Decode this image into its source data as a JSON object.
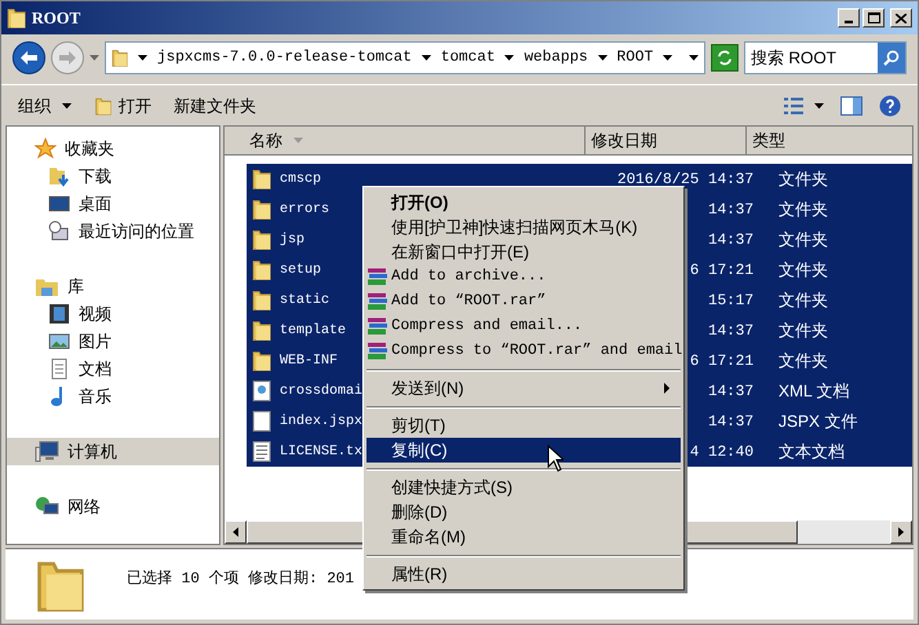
{
  "window": {
    "title": "ROOT"
  },
  "address_bar": {
    "crumbs": [
      "jspxcms-7.0.0-release-tomcat",
      "tomcat",
      "webapps",
      "ROOT"
    ],
    "search_placeholder": "搜索 ROOT"
  },
  "toolbar": {
    "organize": "组织",
    "open": "打开",
    "new_folder": "新建文件夹"
  },
  "sidebar": {
    "groups": [
      {
        "label": "收藏夹",
        "selected": false,
        "children": [
          {
            "label": "下载",
            "selected": false
          },
          {
            "label": "桌面",
            "selected": false
          },
          {
            "label": "最近访问的位置",
            "selected": false
          }
        ]
      },
      {
        "label": "库",
        "selected": false,
        "children": [
          {
            "label": "视频",
            "selected": false
          },
          {
            "label": "图片",
            "selected": false
          },
          {
            "label": "文档",
            "selected": false
          },
          {
            "label": "音乐",
            "selected": false
          }
        ]
      },
      {
        "label": "计算机",
        "selected": true
      },
      {
        "label": "网络",
        "selected": false
      }
    ]
  },
  "table": {
    "columns": [
      "名称",
      "修改日期",
      "类型"
    ],
    "rows": [
      {
        "name": "cmscp",
        "date": "2016/8/25 14:37",
        "type": "文件夹",
        "kind": "folder",
        "selected": true
      },
      {
        "name": "errors",
        "date": "14:37",
        "type": "文件夹",
        "kind": "folder",
        "selected": true
      },
      {
        "name": "jsp",
        "date": "14:37",
        "type": "文件夹",
        "kind": "folder",
        "selected": true
      },
      {
        "name": "setup",
        "date": "6 17:21",
        "type": "文件夹",
        "kind": "folder",
        "selected": true
      },
      {
        "name": "static",
        "date": "15:17",
        "type": "文件夹",
        "kind": "folder",
        "selected": true
      },
      {
        "name": "template",
        "date": "14:37",
        "type": "文件夹",
        "kind": "folder",
        "selected": true
      },
      {
        "name": "WEB-INF",
        "date": "6 17:21",
        "type": "文件夹",
        "kind": "folder",
        "selected": true
      },
      {
        "name": "crossdomai",
        "date": "14:37",
        "type": "XML 文档",
        "kind": "xml",
        "selected": true
      },
      {
        "name": "index.jspx",
        "date": "14:37",
        "type": "JSPX 文件",
        "kind": "file",
        "selected": true
      },
      {
        "name": "LICENSE.tx",
        "date": "4 12:40",
        "type": "文本文档",
        "kind": "text",
        "selected": true
      }
    ]
  },
  "context_menu": {
    "sections": [
      [
        {
          "label": "打开(O)",
          "kind": "plain",
          "bold": true,
          "selected": false
        },
        {
          "label": "使用[护卫神]快速扫描网页木马(K)",
          "kind": "plain",
          "bold": false,
          "selected": false
        },
        {
          "label": "在新窗口中打开(E)",
          "kind": "plain",
          "bold": false,
          "selected": false
        },
        {
          "label": "Add to archive...",
          "kind": "archive",
          "bold": false,
          "selected": false
        },
        {
          "label": "Add to “ROOT.rar”",
          "kind": "archive",
          "bold": false,
          "selected": false
        },
        {
          "label": "Compress and email...",
          "kind": "archive",
          "bold": false,
          "selected": false
        },
        {
          "label": "Compress to “ROOT.rar” and email",
          "kind": "archive",
          "bold": false,
          "selected": false
        }
      ],
      [
        {
          "label": "发送到(N)",
          "kind": "submenu",
          "bold": false,
          "selected": false
        }
      ],
      [
        {
          "label": "剪切(T)",
          "kind": "plain",
          "bold": false,
          "selected": false
        },
        {
          "label": "复制(C)",
          "kind": "plain",
          "bold": false,
          "selected": true
        }
      ],
      [
        {
          "label": "创建快捷方式(S)",
          "kind": "plain",
          "bold": false,
          "selected": false
        },
        {
          "label": "删除(D)",
          "kind": "plain",
          "bold": false,
          "selected": false
        },
        {
          "label": "重命名(M)",
          "kind": "plain",
          "bold": false,
          "selected": false
        }
      ],
      [
        {
          "label": "属性(R)",
          "kind": "plain",
          "bold": false,
          "selected": false
        }
      ]
    ]
  },
  "status_bar": {
    "text": "已选择 10 个项 修改日期: 201"
  }
}
